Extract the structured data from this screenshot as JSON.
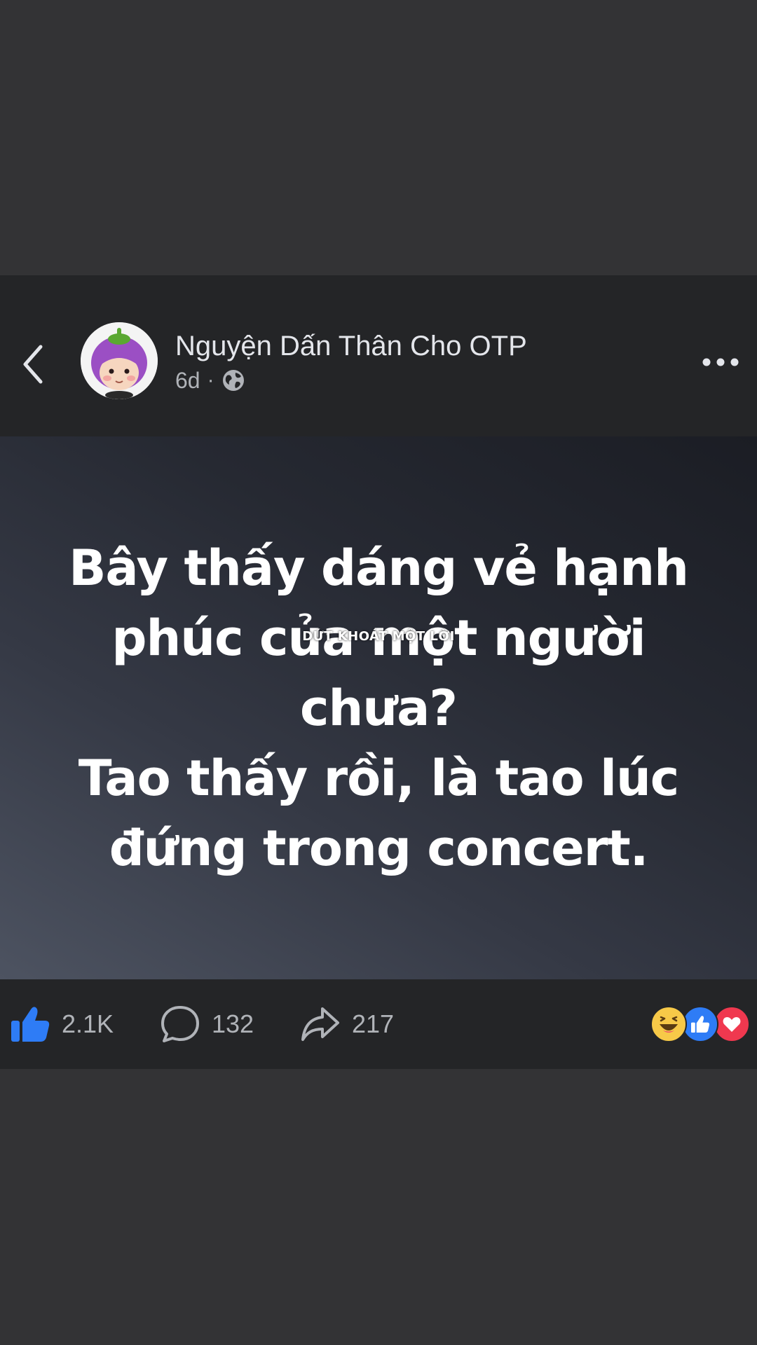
{
  "post": {
    "author_name": "Nguyện Dấn Thân Cho OTP",
    "time": "6d",
    "separator": "·",
    "privacy_icon": "globe-icon",
    "status_text": "Bây thấy dáng vẻ hạnh\nphúc của một người\nchưa?\nTao thấy rồi, là tao lúc\nđứng trong concert.",
    "overlay_caption": "DỨT KHOÁT MỘT LỜI"
  },
  "header": {
    "back_icon": "chevron-left-icon",
    "more_icon": "more-horizontal-icon"
  },
  "actions": {
    "like_count": "2.1K",
    "comment_count": "132",
    "share_count": "217"
  },
  "reactions": [
    "haha-reaction-icon",
    "like-reaction-icon",
    "love-reaction-icon"
  ],
  "colors": {
    "background": "#333335",
    "panel": "#242527",
    "like_blue": "#2e7cf6",
    "love_red": "#f0384f",
    "haha_yellow": "#f7c948",
    "muted_text": "#b0b3b8",
    "primary_text": "#e4e6eb"
  }
}
